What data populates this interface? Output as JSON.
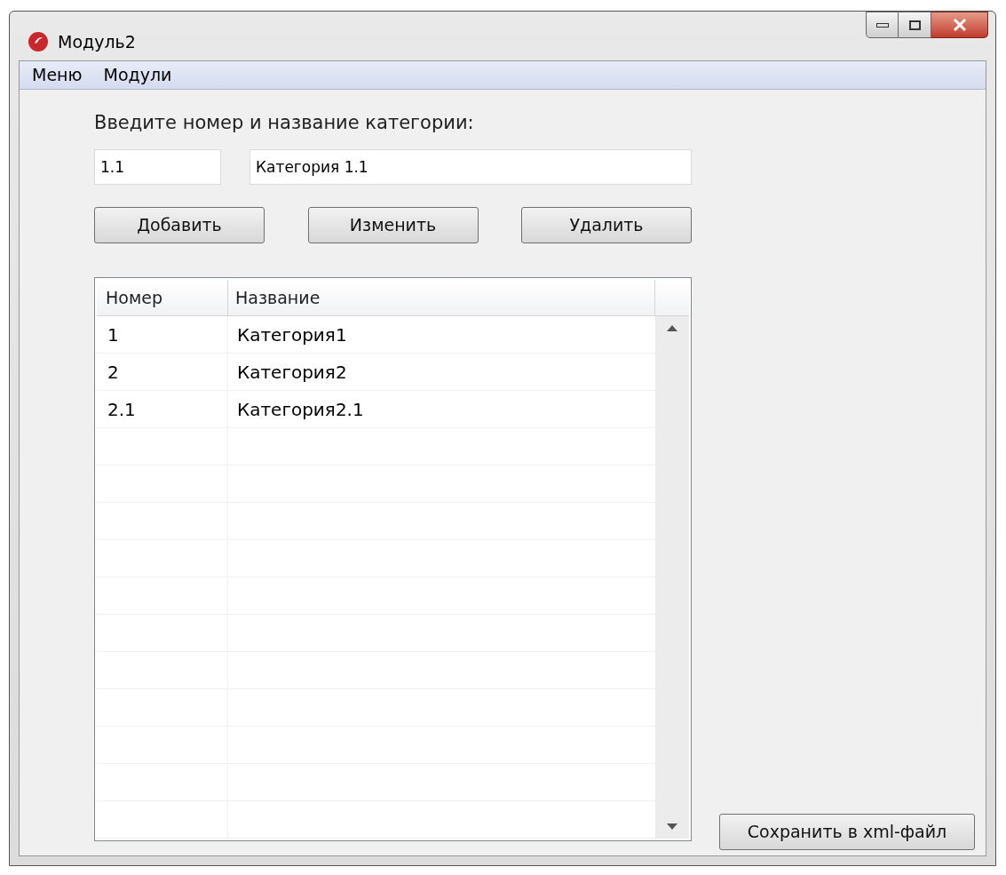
{
  "window": {
    "title": "Модуль2"
  },
  "menu": [
    "Меню",
    "Модули"
  ],
  "form": {
    "prompt": "Введите номер и название категории:",
    "number_value": "1.1",
    "name_value": "Категория 1.1"
  },
  "buttons": [
    "Добавить",
    "Изменить",
    "Удалить"
  ],
  "table": {
    "columns": [
      "Номер",
      "Название"
    ],
    "rows": [
      {
        "number": "1",
        "name": "Категория1"
      },
      {
        "number": "2",
        "name": "Категория2"
      },
      {
        "number": "2.1",
        "name": "Категория2.1"
      }
    ]
  },
  "save_button": "Сохранить в xml-файл"
}
